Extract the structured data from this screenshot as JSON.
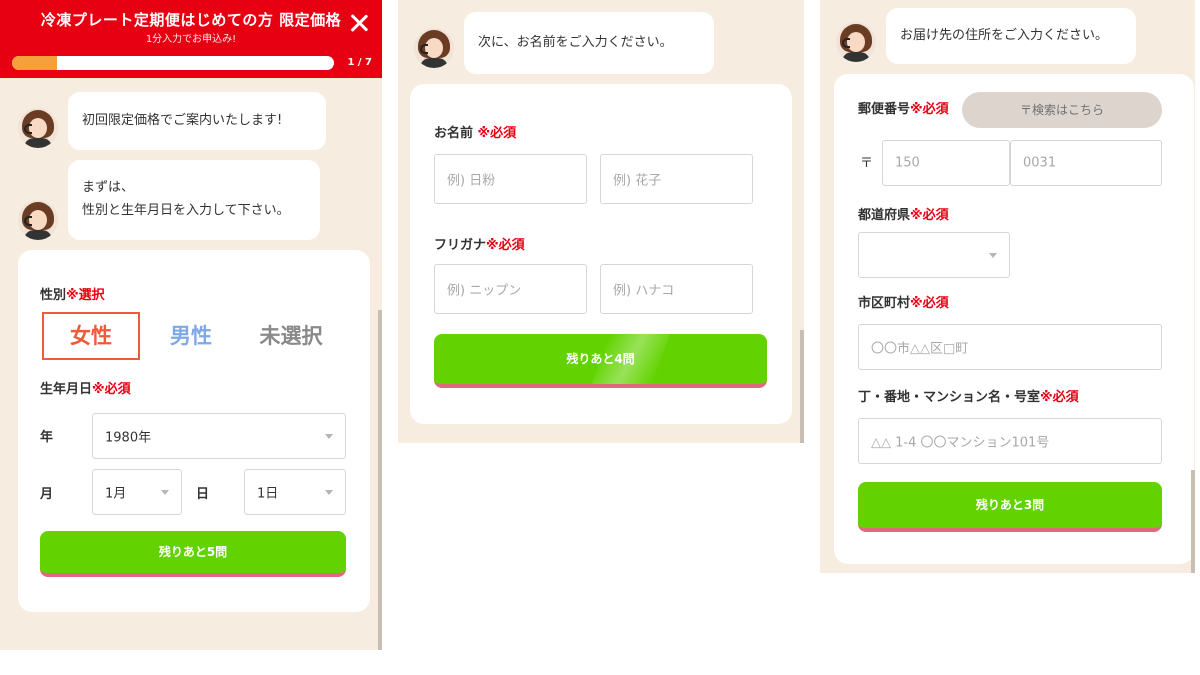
{
  "screen1": {
    "header": {
      "title": "冷凍プレート定期便はじめての方 限定価格",
      "subtitle": "1分入力でお申込み!",
      "progress_text": "1 / 7",
      "progress": 0.14
    },
    "messages": [
      {
        "lines": [
          "初回限定価格でご案内いたします!"
        ]
      },
      {
        "lines": [
          "まずは、",
          "性別と生年月日を入力して下さい。"
        ]
      }
    ],
    "gender": {
      "label": "性別",
      "req": "※選択",
      "options": [
        "女性",
        "男性",
        "未選択"
      ],
      "selected": "女性"
    },
    "birth": {
      "label": "生年月日",
      "req": "※必須",
      "year_label": "年",
      "year_value": "1980年",
      "month_label": "月",
      "month_value": "1月",
      "day_label": "日",
      "day_value": "1日"
    },
    "cta": "残りあと5問"
  },
  "screen2": {
    "message": "次に、お名前をご入力ください。",
    "name": {
      "label": "お名前",
      "req": "※必須",
      "last_placeholder": "例) 日粉",
      "first_placeholder": "例) 花子"
    },
    "kana": {
      "label": "フリガナ",
      "req": "※必須",
      "last_placeholder": "例) ニップン",
      "first_placeholder": "例) ハナコ"
    },
    "cta": "残りあと4問"
  },
  "screen3": {
    "message": "お届け先の住所をご入力ください。",
    "zip": {
      "label": "郵便番号",
      "req": "※必須",
      "search_button": "〒検索はこちら",
      "mark": "〒",
      "first_value": "150",
      "second_value": "0031"
    },
    "pref": {
      "label": "都道府県",
      "req": "※必須",
      "value": ""
    },
    "city": {
      "label": "市区町村",
      "req": "※必須",
      "placeholder": "〇〇市△△区□町"
    },
    "street": {
      "label": "丁・番地・マンション名・号室",
      "req": "※必須",
      "placeholder": "△△ 1-4 〇〇マンション101号"
    },
    "cta": "残りあと3問"
  },
  "colors": {
    "brand_red": "#e60012",
    "cta_green": "#62d300",
    "selected_orange": "#ee5b3a",
    "male_blue": "#7fa8e8",
    "background": "#f7ece0"
  }
}
